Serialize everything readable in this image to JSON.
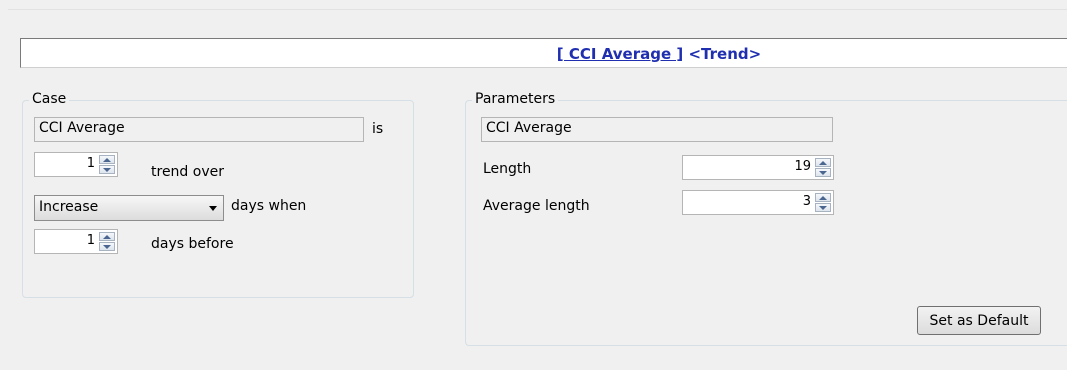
{
  "title": {
    "bracket_part": "[ CCI Average ]",
    "trend_part": "<Trend>"
  },
  "case": {
    "group_label": "Case",
    "indicator": "CCI Average",
    "is_label": "is",
    "trend_over_value": "1",
    "trend_over_label": "trend over",
    "direction_options_selected": "Increase",
    "days_when_label": "days when",
    "days_before_value": "1",
    "days_before_label": "days before"
  },
  "parameters": {
    "group_label": "Parameters",
    "indicator": "CCI Average",
    "length_label": "Length",
    "length_value": "19",
    "average_length_label": "Average length",
    "average_length_value": "3",
    "set_default_label": "Set as Default"
  },
  "colors": {
    "title_text": "#1f2fb0",
    "background": "#f0f0f0"
  }
}
